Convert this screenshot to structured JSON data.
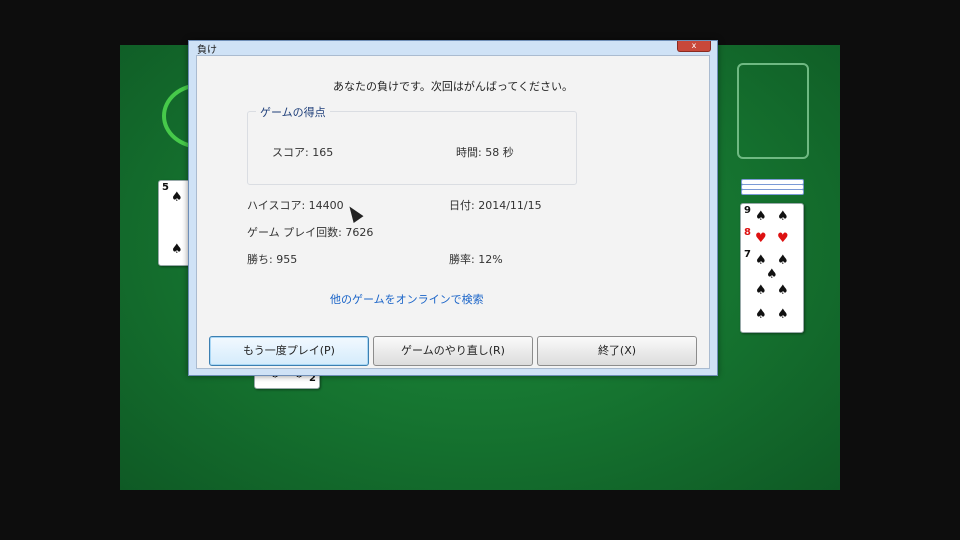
{
  "dialog": {
    "title": "負け",
    "close_label": "x",
    "message": "あなたの負けです。次回はがんばってください。",
    "group_title": "ゲームの得点",
    "score_label": "スコア: 165",
    "time_label": "時間: 58 秒",
    "high_score_label": "ハイスコア: 14400",
    "date_label": "日付: 2014/11/15",
    "games_played_label": "ゲーム プレイ回数: 7626",
    "wins_label": "勝ち: 955",
    "win_rate_label": "勝率: 12%",
    "online_link": "他のゲームをオンラインで検索",
    "buttons": {
      "play_again": "もう一度プレイ(P)",
      "restart": "ゲームのやり直し(R)",
      "exit": "終了(X)"
    }
  },
  "board": {
    "left_card": {
      "rank": "5",
      "suit": "spade"
    },
    "bottom_card": {
      "rank": "2",
      "suit": "spade"
    },
    "right_cards": [
      {
        "rank": "9",
        "suit": "spade"
      },
      {
        "rank": "8",
        "suit": "heart"
      },
      {
        "rank": "7",
        "suit": "spade"
      }
    ],
    "colors": {
      "felt": "#15722f",
      "accent": "#46c94a"
    }
  }
}
